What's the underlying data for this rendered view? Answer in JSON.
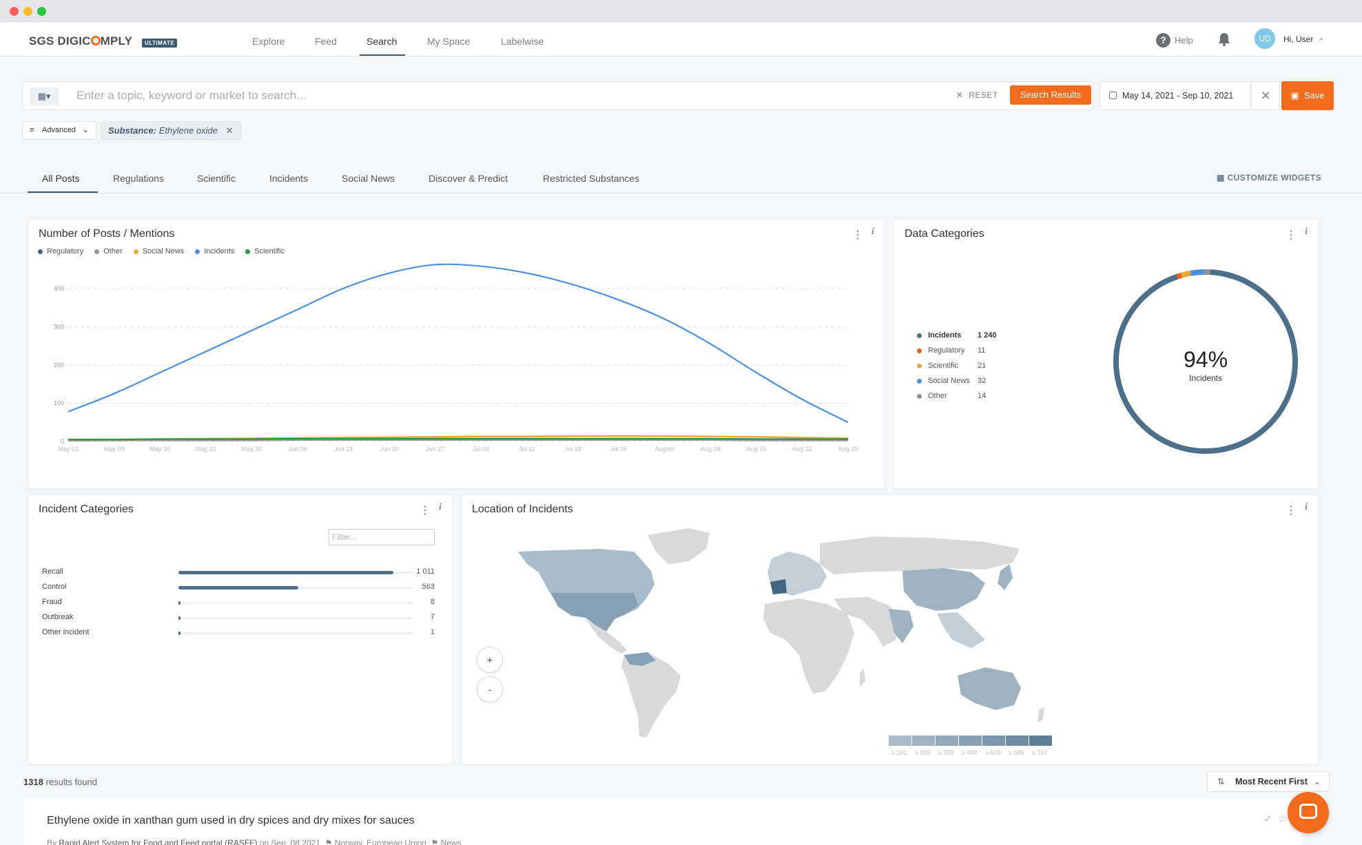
{
  "brand": {
    "name_prefix": "SGS DIGIC",
    "name_suffix": "MPLY",
    "edition": "ULTIMATE",
    "accent_color": "#f26b1d",
    "primary_color": "#3a5a74"
  },
  "nav": {
    "items": [
      {
        "label": "Explore",
        "active": false
      },
      {
        "label": "Feed",
        "active": false
      },
      {
        "label": "Search",
        "active": true
      },
      {
        "label": "My Space",
        "active": false
      },
      {
        "label": "Labelwise",
        "active": false
      }
    ],
    "help_label": "Help",
    "avatar_initials": "UD",
    "user_greeting": "Hi, User"
  },
  "search": {
    "placeholder": "Enter a topic, keyword or market to search...",
    "type_icon": "factory-icon",
    "reset_label": "RESET",
    "submit_label": "Search Results",
    "date_range": "May 14, 2021 - Sep 10, 2021",
    "save_label": "Save",
    "advanced_label": "Advanced",
    "filter_key": "Substance:",
    "filter_value": "Ethylene oxide"
  },
  "tabs": {
    "items": [
      {
        "label": "All Posts",
        "active": true
      },
      {
        "label": "Regulations",
        "active": false
      },
      {
        "label": "Scientific",
        "active": false
      },
      {
        "label": "Incidents",
        "active": false
      },
      {
        "label": "Social News",
        "active": false
      },
      {
        "label": "Discover & Predict",
        "active": false
      },
      {
        "label": "Restricted Substances",
        "active": false
      }
    ],
    "customize_label": "CUSTOMIZE WIDGETS"
  },
  "posts_widget": {
    "title": "Number of Posts / Mentions"
  },
  "chart_data": [
    {
      "type": "line",
      "title": "Number of Posts / Mentions",
      "x": [
        "May 02",
        "May 09",
        "May 16",
        "May 23",
        "May 30",
        "Jun 06",
        "Jun 13",
        "Jun 20",
        "Jun 27",
        "Jul 04",
        "Jul 11",
        "Jul 18",
        "Jul 25",
        "August",
        "Aug 08",
        "Aug 15",
        "Aug 22",
        "Aug 29"
      ],
      "ylim": [
        0,
        450
      ],
      "yticks": [
        0,
        100,
        200,
        300,
        400
      ],
      "grid": true,
      "legend": "top-left",
      "series": [
        {
          "name": "Regulatory",
          "color": "#3f6680",
          "values": [
            3,
            4,
            5,
            5,
            6,
            6,
            6,
            7,
            7,
            7,
            7,
            7,
            7,
            7,
            6,
            6,
            5,
            4
          ]
        },
        {
          "name": "Other",
          "color": "#9a9a9a",
          "values": [
            2,
            3,
            3,
            3,
            3,
            4,
            4,
            4,
            4,
            4,
            4,
            4,
            4,
            4,
            4,
            3,
            3,
            3
          ]
        },
        {
          "name": "Social News",
          "color": "#e8a93a",
          "values": [
            4,
            5,
            6,
            7,
            8,
            9,
            10,
            11,
            12,
            13,
            13,
            14,
            14,
            14,
            13,
            12,
            10,
            8
          ]
        },
        {
          "name": "Incidents",
          "color": "#4a90e2",
          "values": [
            78,
            125,
            180,
            235,
            290,
            345,
            400,
            440,
            462,
            458,
            440,
            410,
            370,
            320,
            255,
            180,
            110,
            50
          ]
        },
        {
          "name": "Scientific",
          "color": "#2e9a47",
          "values": [
            5,
            5,
            6,
            6,
            6,
            7,
            7,
            7,
            7,
            7,
            7,
            7,
            7,
            7,
            7,
            6,
            6,
            6
          ]
        }
      ]
    },
    {
      "type": "pie",
      "title": "Data Categories",
      "center_value": "94%",
      "center_label": "Incidents",
      "legend": "left",
      "slices": [
        {
          "name": "Incidents",
          "value": 1240,
          "display": "1 240",
          "color": "#4d6f8a"
        },
        {
          "name": "Regulatory",
          "value": 11,
          "display": "11",
          "color": "#e8621a"
        },
        {
          "name": "Scientific",
          "value": 21,
          "display": "21",
          "color": "#e8a93a"
        },
        {
          "name": "Social News",
          "value": 32,
          "display": "32",
          "color": "#4a90e2"
        },
        {
          "name": "Other",
          "value": 14,
          "display": "14",
          "color": "#8f9396"
        }
      ]
    },
    {
      "type": "bar",
      "title": "Incident Categories",
      "categories": [
        "Recall",
        "Control",
        "Fraud",
        "Outbreak",
        "Other incident"
      ],
      "values": [
        1011,
        563,
        8,
        7,
        1
      ],
      "display": [
        "1 011",
        "563",
        "8",
        "7",
        "1"
      ],
      "xlim": [
        0,
        1100
      ]
    }
  ],
  "data_categories_widget": {
    "title": "Data Categories"
  },
  "incident_categories_widget": {
    "title": "Incident Categories",
    "filter_placeholder": "Filter..."
  },
  "map_widget": {
    "title": "Location of Incidents",
    "zoom_in": "+",
    "zoom_out": "-",
    "scale": [
      {
        "label": "≥ 101",
        "color": "#a9bac8"
      },
      {
        "label": "≥ 202",
        "color": "#9eb2c2"
      },
      {
        "label": "≥ 303",
        "color": "#92a9bb"
      },
      {
        "label": "≥ 404",
        "color": "#87a0b4"
      },
      {
        "label": "≥ 505",
        "color": "#7b96ac"
      },
      {
        "label": "≥ 606",
        "color": "#6f8ca4"
      },
      {
        "label": "≥ 707",
        "color": "#5f7f99"
      }
    ]
  },
  "results": {
    "count": "1318",
    "count_suffix": "results found",
    "sort_label": "Most Recent First",
    "first": {
      "title": "Ethylene oxide in xanthan gum used in dry spices and dry mixes for sauces",
      "by": "By",
      "source": "Rapid Alert System for Food and Feed portal (RASFF)",
      "on": "on Sep. 08 2021",
      "regions": "Norway, European Union",
      "type": "News"
    }
  }
}
